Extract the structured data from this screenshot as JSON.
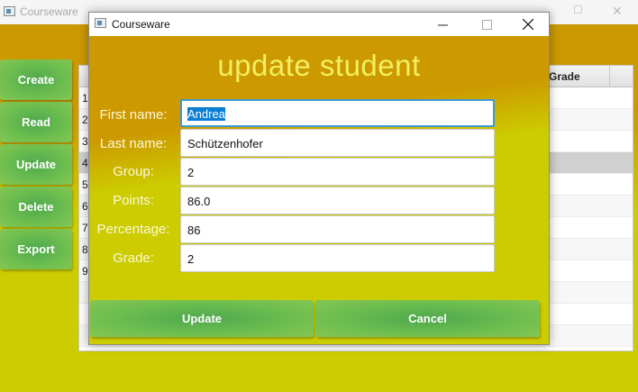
{
  "main_window": {
    "title": "Courseware",
    "side_buttons": [
      "Create",
      "Read",
      "Update",
      "Delete",
      "Export"
    ],
    "table": {
      "visible_header": "Grade",
      "row_numbers": [
        "1",
        "2",
        "3",
        "4",
        "5",
        "6",
        "7",
        "8",
        "9"
      ],
      "selected_row": "4"
    }
  },
  "dialog": {
    "title": "Courseware",
    "heading": "update student",
    "fields": [
      {
        "label": "First name:",
        "value": "Andrea"
      },
      {
        "label": "Last name:",
        "value": "Schützenhofer"
      },
      {
        "label": "Group:",
        "value": "2"
      },
      {
        "label": "Points:",
        "value": "86.0"
      },
      {
        "label": "Percentage:",
        "value": "86"
      },
      {
        "label": "Grade:",
        "value": "2"
      }
    ],
    "update_label": "Update",
    "cancel_label": "Cancel"
  },
  "colors": {
    "header_orange": "#cc9900",
    "body_yellow": "#cccc00",
    "button_green": "#5cb85c",
    "heading_text": "#f3ef60",
    "selection_blue": "#0a7fd4"
  },
  "icons": [
    "app-icon",
    "minimize-icon",
    "maximize-icon",
    "close-icon"
  ]
}
